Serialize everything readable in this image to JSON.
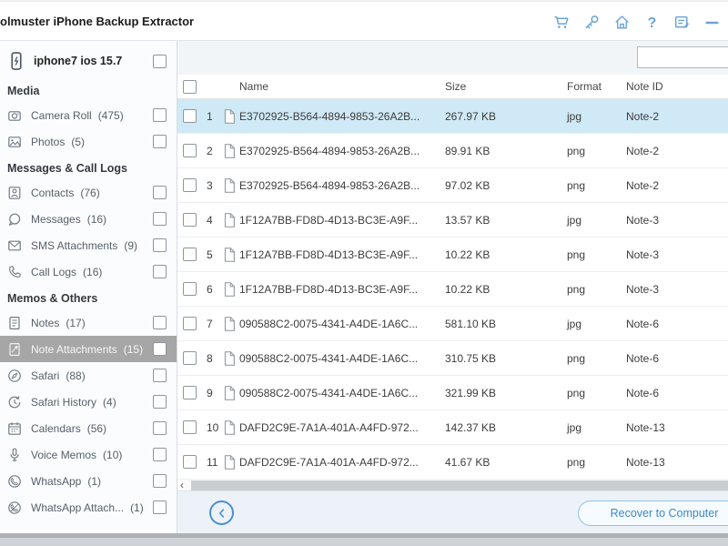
{
  "titlebar": {
    "title": "olmuster iPhone Backup Extractor",
    "icons": [
      "cart-icon",
      "key-icon",
      "home-icon",
      "help-icon",
      "feedback-icon",
      "minimize-icon"
    ]
  },
  "sidebar": {
    "device": {
      "label": "iphone7 ios 15.7",
      "icon": "device-phone-icon"
    },
    "sections": [
      {
        "label": "Media",
        "items": [
          {
            "label": "Camera Roll",
            "count": "(475)",
            "icon": "camera-icon",
            "selected": false
          },
          {
            "label": "Photos",
            "count": "(5)",
            "icon": "photos-icon",
            "selected": false
          }
        ]
      },
      {
        "label": "Messages & Call Logs",
        "items": [
          {
            "label": "Contacts",
            "count": "(76)",
            "icon": "contacts-icon",
            "selected": false
          },
          {
            "label": "Messages",
            "count": "(16)",
            "icon": "messages-icon",
            "selected": false
          },
          {
            "label": "SMS Attachments",
            "count": "(9)",
            "icon": "sms-attachments-icon",
            "selected": false
          },
          {
            "label": "Call Logs",
            "count": "(16)",
            "icon": "call-logs-icon",
            "selected": false
          }
        ]
      },
      {
        "label": "Memos & Others",
        "items": [
          {
            "label": "Notes",
            "count": "(17)",
            "icon": "notes-icon",
            "selected": false
          },
          {
            "label": "Note Attachments",
            "count": "(15)",
            "icon": "note-attachments-icon",
            "selected": true
          },
          {
            "label": "Safari",
            "count": "(88)",
            "icon": "safari-icon",
            "selected": false
          },
          {
            "label": "Safari History",
            "count": "(4)",
            "icon": "safari-history-icon",
            "selected": false
          },
          {
            "label": "Calendars",
            "count": "(56)",
            "icon": "calendars-icon",
            "selected": false
          },
          {
            "label": "Voice Memos",
            "count": "(10)",
            "icon": "voice-memos-icon",
            "selected": false
          },
          {
            "label": "WhatsApp",
            "count": "(1)",
            "icon": "whatsapp-icon",
            "selected": false
          },
          {
            "label": "WhatsApp Attach...",
            "count": "(1)",
            "icon": "whatsapp-attachments-icon",
            "selected": false
          }
        ]
      }
    ]
  },
  "main": {
    "search": {
      "value": "",
      "placeholder": ""
    },
    "table": {
      "columns": [
        "Name",
        "Size",
        "Format",
        "Note ID"
      ],
      "rows": [
        {
          "num": "1",
          "name": "E3702925-B564-4894-9853-26A2B...",
          "size": "267.97 KB",
          "format": "jpg",
          "note_id": "Note-2",
          "selected": true
        },
        {
          "num": "2",
          "name": "E3702925-B564-4894-9853-26A2B...",
          "size": "89.91 KB",
          "format": "png",
          "note_id": "Note-2",
          "selected": false
        },
        {
          "num": "3",
          "name": "E3702925-B564-4894-9853-26A2B...",
          "size": "97.02 KB",
          "format": "png",
          "note_id": "Note-2",
          "selected": false
        },
        {
          "num": "4",
          "name": "1F12A7BB-FD8D-4D13-BC3E-A9F...",
          "size": "13.57 KB",
          "format": "jpg",
          "note_id": "Note-3",
          "selected": false
        },
        {
          "num": "5",
          "name": "1F12A7BB-FD8D-4D13-BC3E-A9F...",
          "size": "10.22 KB",
          "format": "png",
          "note_id": "Note-3",
          "selected": false
        },
        {
          "num": "6",
          "name": "1F12A7BB-FD8D-4D13-BC3E-A9F...",
          "size": "10.22 KB",
          "format": "png",
          "note_id": "Note-3",
          "selected": false
        },
        {
          "num": "7",
          "name": "090588C2-0075-4341-A4DE-1A6C...",
          "size": "581.10 KB",
          "format": "jpg",
          "note_id": "Note-6",
          "selected": false
        },
        {
          "num": "8",
          "name": "090588C2-0075-4341-A4DE-1A6C...",
          "size": "310.75 KB",
          "format": "png",
          "note_id": "Note-6",
          "selected": false
        },
        {
          "num": "9",
          "name": "090588C2-0075-4341-A4DE-1A6C...",
          "size": "321.99 KB",
          "format": "png",
          "note_id": "Note-6",
          "selected": false
        },
        {
          "num": "10",
          "name": "DAFD2C9E-7A1A-401A-A4FD-972...",
          "size": "142.37 KB",
          "format": "jpg",
          "note_id": "Note-13",
          "selected": false
        },
        {
          "num": "11",
          "name": "DAFD2C9E-7A1A-401A-A4FD-972...",
          "size": "41.67 KB",
          "format": "png",
          "note_id": "Note-13",
          "selected": false
        }
      ]
    },
    "footer": {
      "recover_label": "Recover to Computer"
    }
  },
  "colors": {
    "accent_blue": "#6ba3d6",
    "selected_row_bg": "#cfe9f6",
    "selected_sidebar_bg": "#a6a6a6",
    "button_text_blue": "#3f87c9"
  }
}
